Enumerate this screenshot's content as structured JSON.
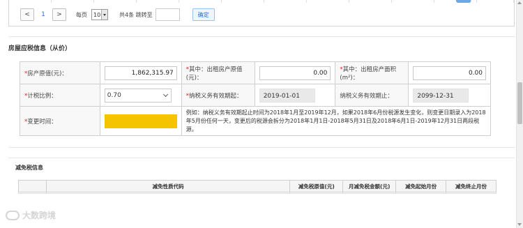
{
  "pager": {
    "prev": "<",
    "page": "1",
    "next": ">",
    "per_page_label": "每页",
    "per_page_value": "10",
    "total_text": "共4条 跳转至",
    "jump_value": "",
    "confirm": "确定"
  },
  "house_section": {
    "title": "房屋应税信息（从价）",
    "original_value_label": "房产原值(元)：",
    "original_value": "1,862,315.97",
    "rent_value_label": "其中：出租房产原值(元)：",
    "rent_value": "0.00",
    "rent_area_label": "其中：出租房产面积(m²)：",
    "rent_area": "0.00",
    "tax_ratio_label": "计税比例：",
    "tax_ratio": "0.70",
    "start_label": "纳税义务有效期起：",
    "start_date": "2019-01-01",
    "end_label": "纳税义务有效期止：",
    "end_date": "2099-12-31",
    "change_time_label": "变更时间：",
    "note": "例如：纳税义务有效期起止时间为2018年1月至2019年12月，如果2018年6月份税源发生变化，则变更日期录入为2018年5月份任何一天，变更后的税源会拆分为2018年1月1日-2018年5月31日及2018年6月1日-2019年12月31日两段税源。",
    "required_mark": "*"
  },
  "reduction_section": {
    "title": "减免税信息",
    "columns": [
      "",
      "减免性质代码",
      "减免税原值(元)",
      "月减免税金额(元)",
      "减免起始月份",
      "减免终止月份"
    ]
  },
  "watermark": {
    "text": "大数跨境"
  },
  "colors": {
    "required": "#e02020",
    "link": "#2a6fd6",
    "highlight": "#f5c400"
  }
}
